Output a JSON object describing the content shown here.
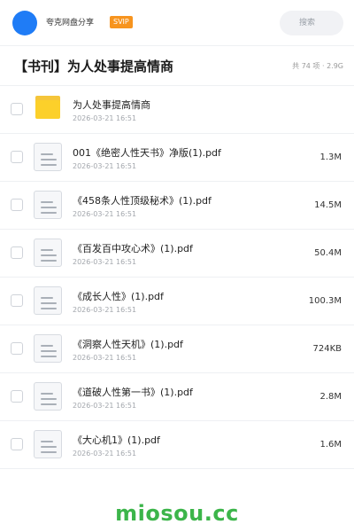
{
  "header": {
    "brand": "夸克网盘分享",
    "badge": "SVIP",
    "search_placeholder": "搜索",
    "accent": "#1f7cf6",
    "badge_color": "#f7941e"
  },
  "folder": {
    "title": "【书刊】为人处事提高情商",
    "meta": "共 74 项 · 2.9G"
  },
  "files": [
    {
      "name": "为人处事提高情商",
      "date": "2026-03-21 16:51",
      "size": "",
      "icon": "folder-icon"
    },
    {
      "name": "001《绝密人性天书》净版(1).pdf",
      "date": "2026-03-21 16:51",
      "size": "1.3M",
      "icon": "document-icon"
    },
    {
      "name": "《458条人性顶级秘术》(1).pdf",
      "date": "2026-03-21 16:51",
      "size": "14.5M",
      "icon": "document-icon"
    },
    {
      "name": "《百发百中攻心术》(1).pdf",
      "date": "2026-03-21 16:51",
      "size": "50.4M",
      "icon": "document-icon"
    },
    {
      "name": "《成长人性》(1).pdf",
      "date": "2026-03-21 16:51",
      "size": "100.3M",
      "icon": "document-icon"
    },
    {
      "name": "《洞察人性天机》(1).pdf",
      "date": "2026-03-21 16:51",
      "size": "724KB",
      "icon": "document-icon"
    },
    {
      "name": "《道破人性第一书》(1).pdf",
      "date": "2026-03-21 16:51",
      "size": "2.8M",
      "icon": "document-icon"
    },
    {
      "name": "《大心机1》(1).pdf",
      "date": "2026-03-21 16:51",
      "size": "1.6M",
      "icon": "document-icon"
    }
  ],
  "watermark": "miosou.cc"
}
